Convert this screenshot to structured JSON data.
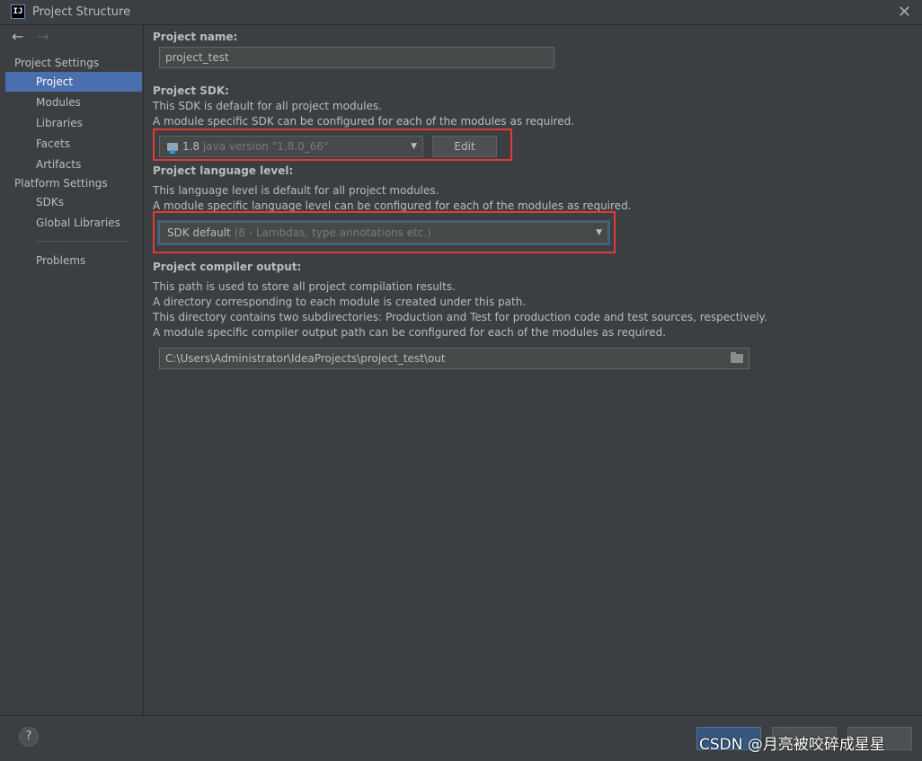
{
  "window": {
    "title": "Project Structure",
    "app_icon_text": "IJ",
    "close_glyph": "✕"
  },
  "nav": {
    "back_glyph": "←",
    "forward_glyph": "→"
  },
  "sidebar": {
    "project_settings_header": "Project Settings",
    "project_settings_items": [
      {
        "label": "Project",
        "selected": true
      },
      {
        "label": "Modules",
        "selected": false
      },
      {
        "label": "Libraries",
        "selected": false
      },
      {
        "label": "Facets",
        "selected": false
      },
      {
        "label": "Artifacts",
        "selected": false
      }
    ],
    "platform_settings_header": "Platform Settings",
    "platform_settings_items": [
      {
        "label": "SDKs"
      },
      {
        "label": "Global Libraries"
      }
    ],
    "problems_label": "Problems"
  },
  "project": {
    "name_label": "Project name:",
    "name_value": "project_test",
    "sdk_label": "Project SDK:",
    "sdk_desc_1": "This SDK is default for all project modules.",
    "sdk_desc_2": "A module specific SDK can be configured for each of the modules as required.",
    "sdk_selected_name": "1.8",
    "sdk_selected_detail": "java version \"1.8.0_66\"",
    "sdk_edit_button": "Edit",
    "lang_label": "Project language level:",
    "lang_desc_1": "This language level is default for all project modules.",
    "lang_desc_2": "A module specific language level can be configured for each of the modules as required.",
    "lang_selected": "SDK default",
    "lang_selected_detail": "(8 - Lambdas, type annotations etc.)",
    "output_label": "Project compiler output:",
    "output_desc_1": "This path is used to store all project compilation results.",
    "output_desc_2": "A directory corresponding to each module is created under this path.",
    "output_desc_3": "This directory contains two subdirectories: Production and Test for production code and test sources, respectively.",
    "output_desc_4": "A module specific compiler output path can be configured for each of the modules as required.",
    "output_path": "C:\\Users\\Administrator\\IdeaProjects\\project_test\\out"
  },
  "footer": {
    "help_glyph": "?",
    "watermark": "CSDN @月亮被咬碎成星星"
  },
  "colors": {
    "background": "#3c3f41",
    "selection": "#4b6eaf",
    "highlight_box": "#e23a3a",
    "primary_button": "#365880"
  }
}
